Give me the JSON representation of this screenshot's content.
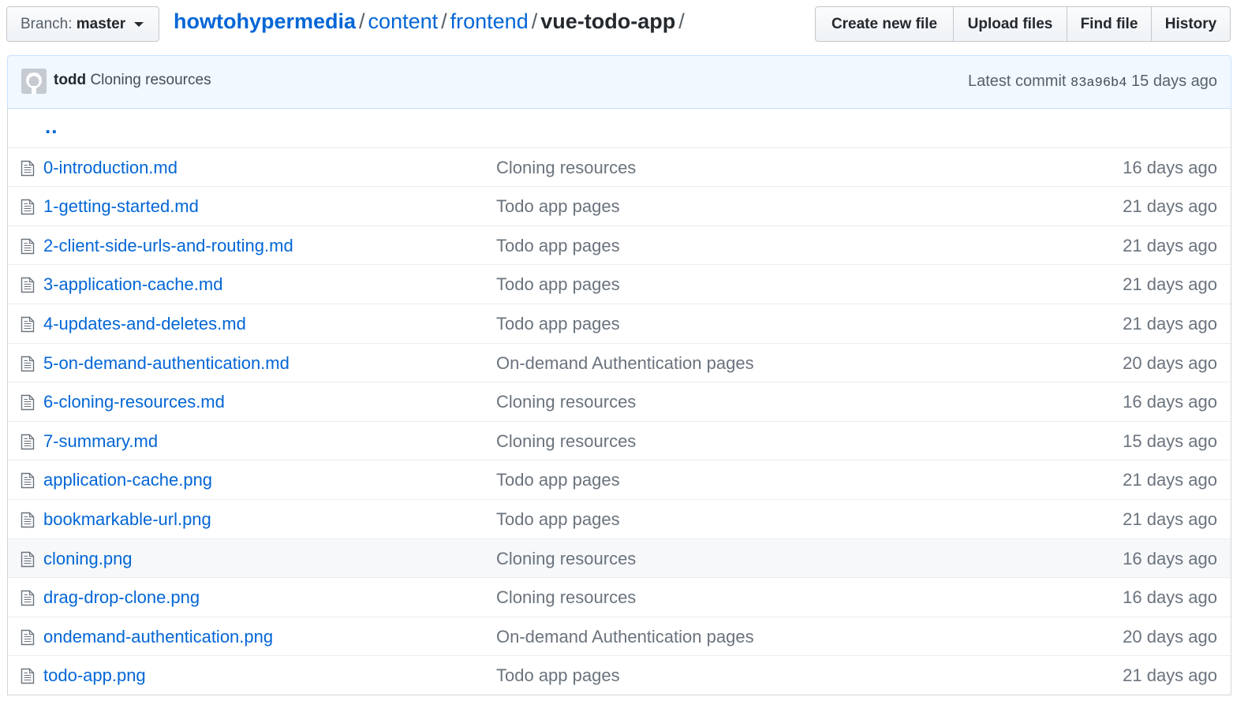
{
  "branch": {
    "label": "Branch:",
    "name": "master"
  },
  "breadcrumb": {
    "root": "howtohypermedia",
    "seg1": "content",
    "seg2": "frontend",
    "current": "vue-todo-app",
    "sep": "/"
  },
  "actions": [
    {
      "label": "Create new file",
      "name": "create-new-file-button"
    },
    {
      "label": "Upload files",
      "name": "upload-files-button"
    },
    {
      "label": "Find file",
      "name": "find-file-button"
    },
    {
      "label": "History",
      "name": "history-button"
    }
  ],
  "commit": {
    "author": "todd",
    "message": "Cloning resources",
    "latest_label": "Latest commit",
    "sha": "83a96b4",
    "age": "15 days ago"
  },
  "parent_link": "..",
  "files": [
    {
      "name": "0-introduction.md",
      "message": "Cloning resources",
      "age": "16 days ago"
    },
    {
      "name": "1-getting-started.md",
      "message": "Todo app pages",
      "age": "21 days ago"
    },
    {
      "name": "2-client-side-urls-and-routing.md",
      "message": "Todo app pages",
      "age": "21 days ago"
    },
    {
      "name": "3-application-cache.md",
      "message": "Todo app pages",
      "age": "21 days ago"
    },
    {
      "name": "4-updates-and-deletes.md",
      "message": "Todo app pages",
      "age": "21 days ago"
    },
    {
      "name": "5-on-demand-authentication.md",
      "message": "On-demand Authentication pages",
      "age": "20 days ago"
    },
    {
      "name": "6-cloning-resources.md",
      "message": "Cloning resources",
      "age": "16 days ago"
    },
    {
      "name": "7-summary.md",
      "message": "Cloning resources",
      "age": "15 days ago"
    },
    {
      "name": "application-cache.png",
      "message": "Todo app pages",
      "age": "21 days ago"
    },
    {
      "name": "bookmarkable-url.png",
      "message": "Todo app pages",
      "age": "21 days ago"
    },
    {
      "name": "cloning.png",
      "message": "Cloning resources",
      "age": "16 days ago",
      "highlighted": true
    },
    {
      "name": "drag-drop-clone.png",
      "message": "Cloning resources",
      "age": "16 days ago"
    },
    {
      "name": "ondemand-authentication.png",
      "message": "On-demand Authentication pages",
      "age": "20 days ago"
    },
    {
      "name": "todo-app.png",
      "message": "Todo app pages",
      "age": "21 days ago"
    }
  ],
  "colors": {
    "link": "#0366d6",
    "muted": "#6a737d",
    "commit_bg": "#f1f8ff",
    "border": "#d1d5da"
  }
}
